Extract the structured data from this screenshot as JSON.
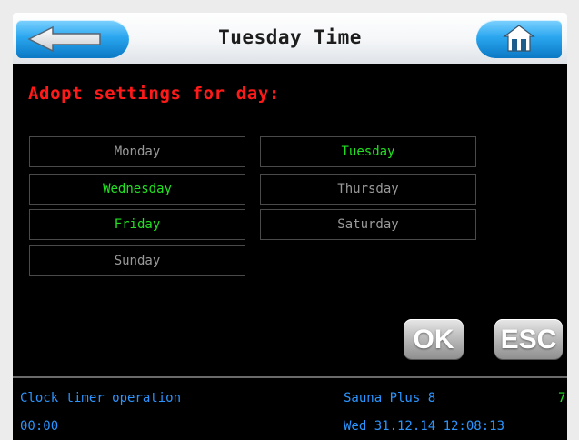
{
  "header": {
    "title": "Tuesday Time",
    "back_icon": "back-arrow-icon",
    "home_icon": "home-icon"
  },
  "main": {
    "heading": "Adopt settings for day:",
    "days": [
      {
        "label": "Monday",
        "active": false
      },
      {
        "label": "Tuesday",
        "active": true
      },
      {
        "label": "Wednesday",
        "active": true
      },
      {
        "label": "Thursday",
        "active": false
      },
      {
        "label": "Friday",
        "active": true
      },
      {
        "label": "Saturday",
        "active": false
      },
      {
        "label": "Sunday",
        "active": false
      }
    ],
    "ok_label": "OK",
    "esc_label": "ESC"
  },
  "footer": {
    "mode": "Clock timer operation",
    "time": "00:00",
    "device": "Sauna Plus 8",
    "number": "7",
    "datetime": "Wed 31.12.14 12:08:13"
  },
  "colors": {
    "active_day": "#22e022",
    "inactive_day": "#9a9a9a",
    "heading": "#ff1a1a",
    "footer_text": "#2b95ff",
    "button_blue": "#2aa6ef"
  }
}
